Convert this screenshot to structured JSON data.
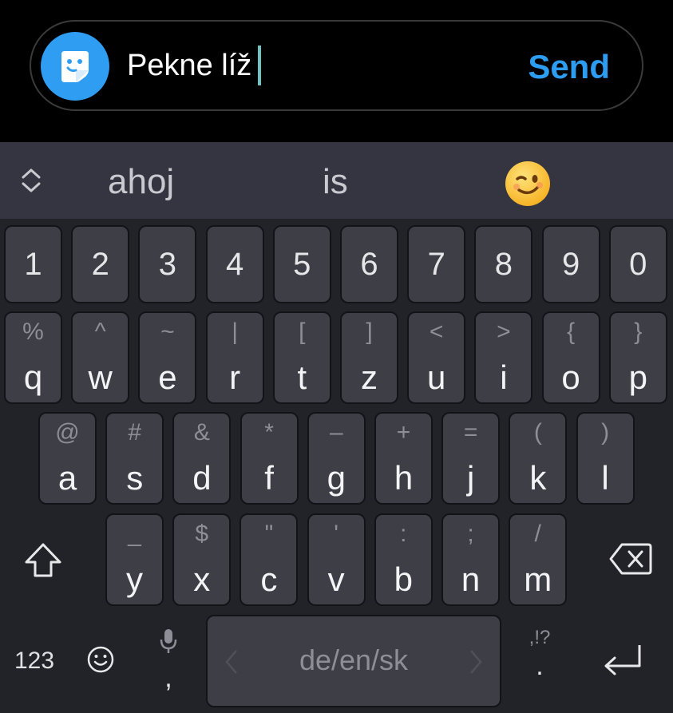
{
  "compose": {
    "text": "Pekne líž",
    "send_label": "Send",
    "sticker_icon": "sticker-smiley-icon",
    "accent_color": "#2c9df0"
  },
  "suggestions": {
    "expand_icon": "chevron-up-down-icon",
    "words": [
      "ahoj",
      "is"
    ],
    "emoji_icon": "winking-face-emoji"
  },
  "keyboard": {
    "number_row": [
      "1",
      "2",
      "3",
      "4",
      "5",
      "6",
      "7",
      "8",
      "9",
      "0"
    ],
    "row1": [
      {
        "hint": "%",
        "main": "q"
      },
      {
        "hint": "^",
        "main": "w"
      },
      {
        "hint": "~",
        "main": "e"
      },
      {
        "hint": "|",
        "main": "r"
      },
      {
        "hint": "[",
        "main": "t"
      },
      {
        "hint": "]",
        "main": "z"
      },
      {
        "hint": "<",
        "main": "u"
      },
      {
        "hint": ">",
        "main": "i"
      },
      {
        "hint": "{",
        "main": "o"
      },
      {
        "hint": "}",
        "main": "p"
      }
    ],
    "row2": [
      {
        "hint": "@",
        "main": "a"
      },
      {
        "hint": "#",
        "main": "s"
      },
      {
        "hint": "&",
        "main": "d"
      },
      {
        "hint": "*",
        "main": "f"
      },
      {
        "hint": "–",
        "main": "g"
      },
      {
        "hint": "+",
        "main": "h"
      },
      {
        "hint": "=",
        "main": "j"
      },
      {
        "hint": "(",
        "main": "k"
      },
      {
        "hint": ")",
        "main": "l"
      }
    ],
    "row3": [
      {
        "hint": "_",
        "main": "y"
      },
      {
        "hint": "$",
        "main": "x"
      },
      {
        "hint": "\"",
        "main": "c"
      },
      {
        "hint": "'",
        "main": "v"
      },
      {
        "hint": ":",
        "main": "b"
      },
      {
        "hint": ";",
        "main": "n"
      },
      {
        "hint": "/",
        "main": "m"
      }
    ],
    "shift_icon": "shift-arrow-icon",
    "backspace_icon": "backspace-icon",
    "symbols_label": "123",
    "emoji_key_icon": "smiley-icon",
    "comma_label": ",",
    "mic_icon": "microphone-icon",
    "space_label": "de/en/sk",
    "period_hint": ",!?",
    "period_label": ".",
    "enter_icon": "enter-arrow-icon"
  }
}
